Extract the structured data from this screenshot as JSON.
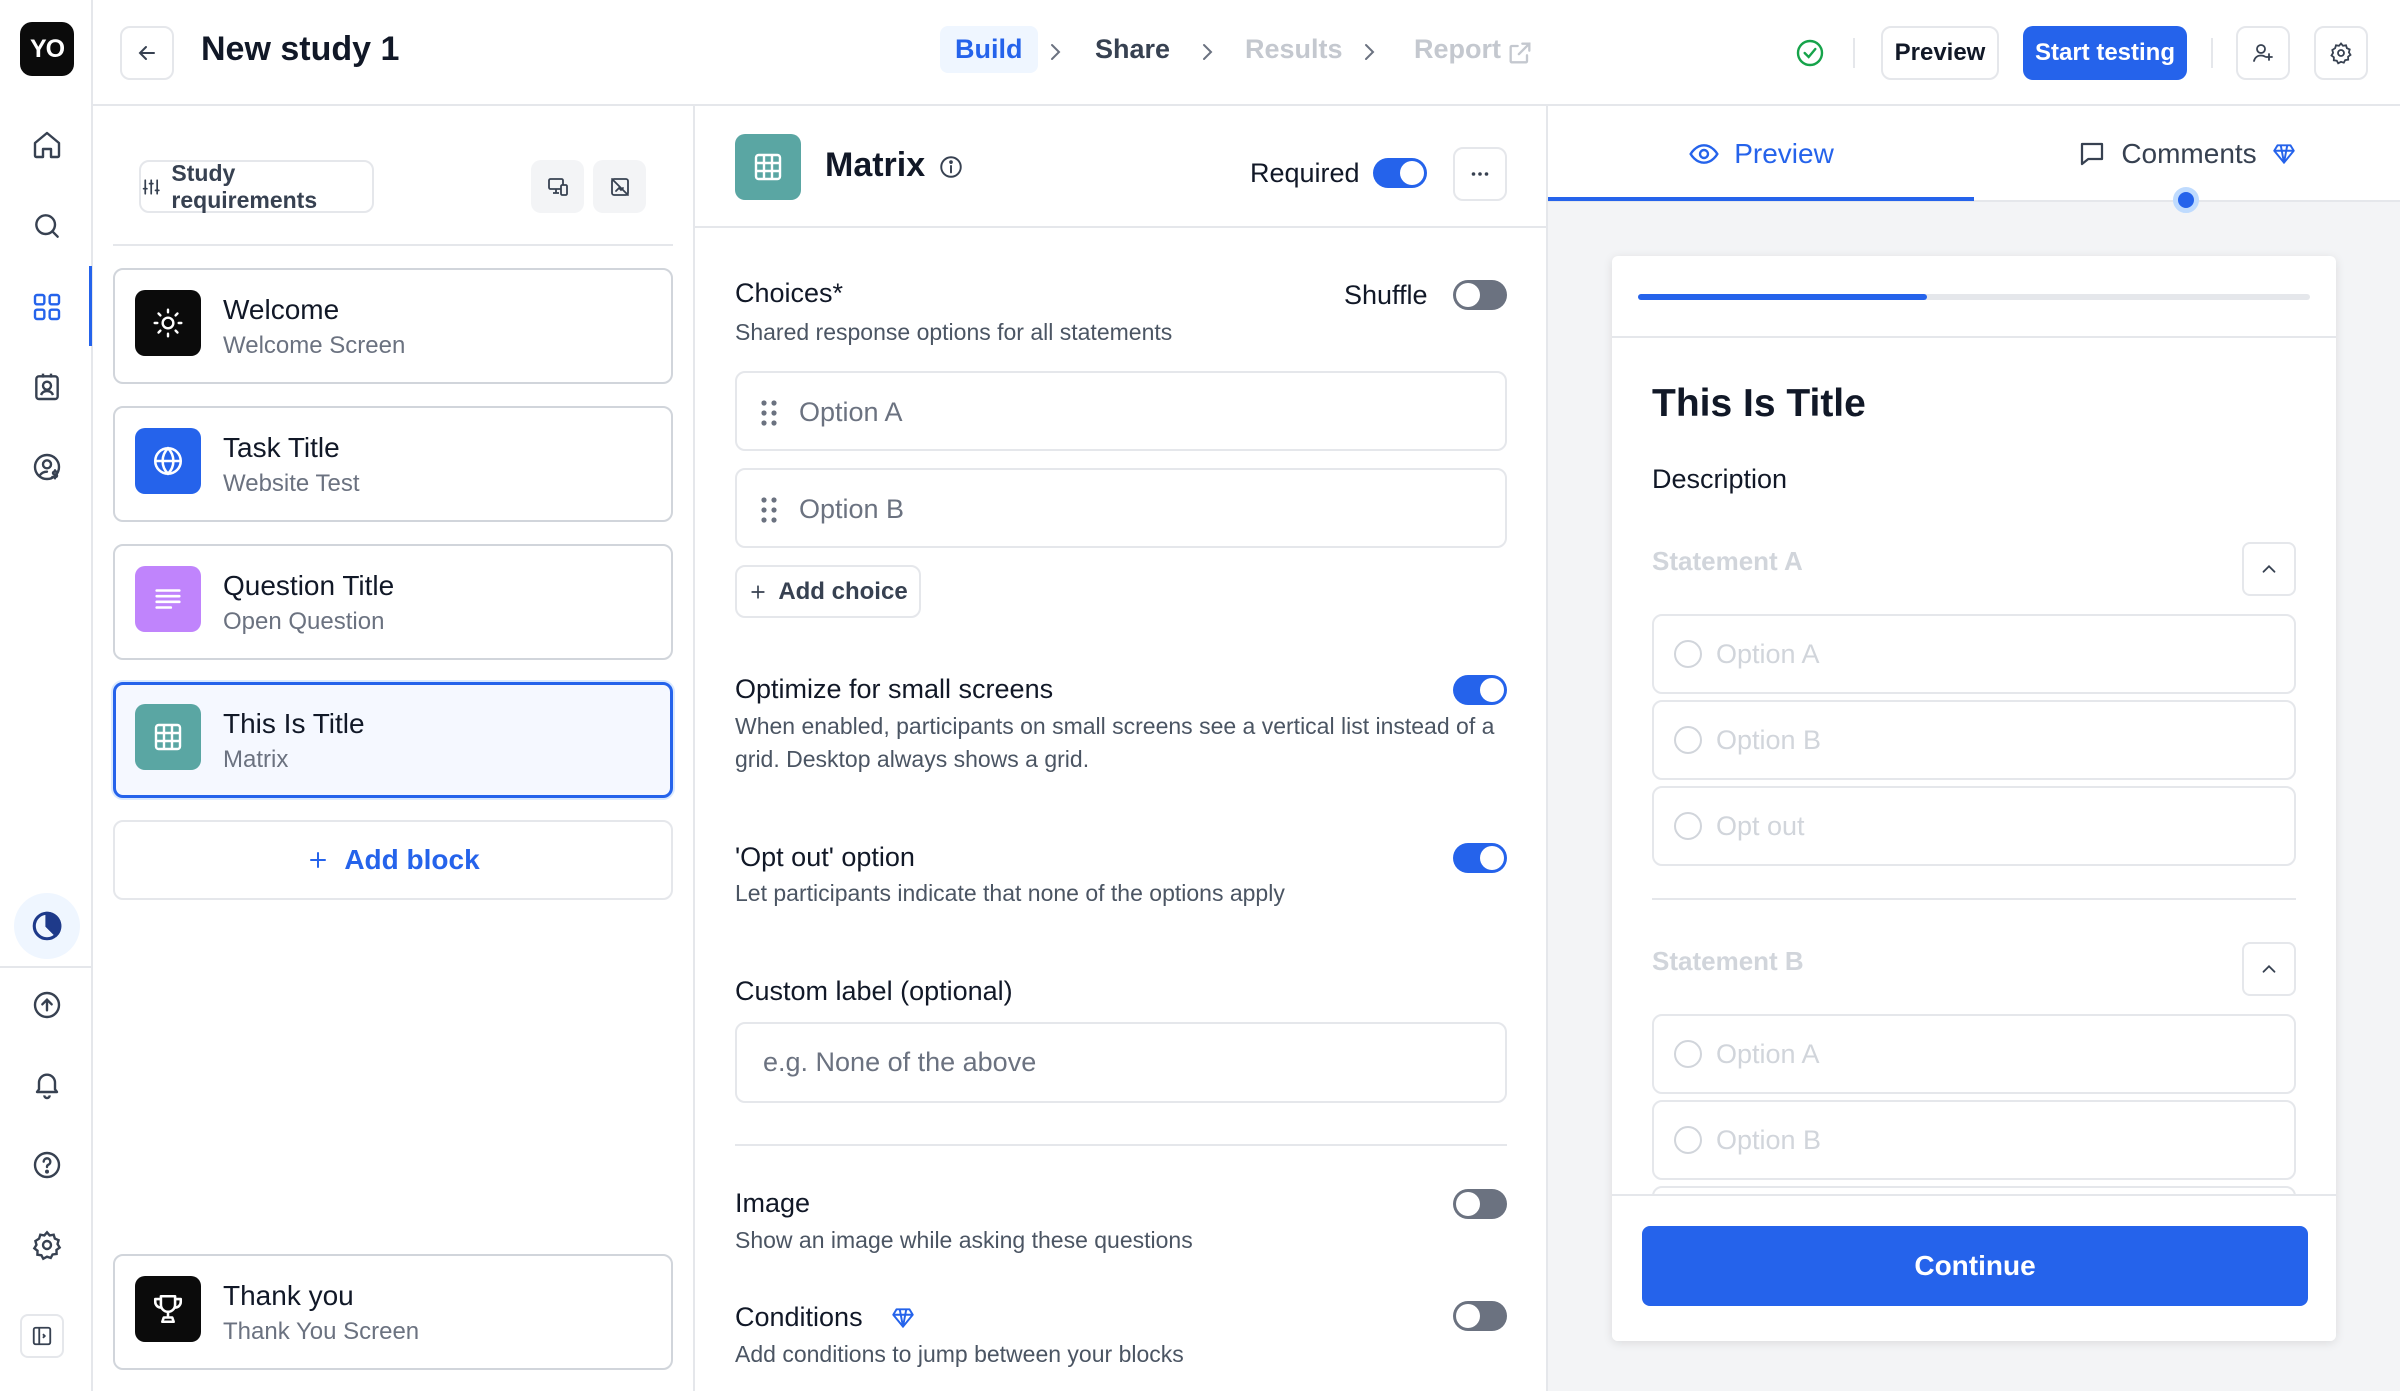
{
  "app": {
    "logo_text": "YO",
    "study_title": "New study 1"
  },
  "nav": {
    "steps": [
      {
        "label": "Build",
        "state": "active"
      },
      {
        "label": "Share",
        "state": "enabled"
      },
      {
        "label": "Results",
        "state": "disabled"
      },
      {
        "label": "Report",
        "state": "disabled"
      }
    ],
    "preview_label": "Preview",
    "start_label": "Start testing"
  },
  "blocks_panel": {
    "requirements_label": "Study requirements",
    "blocks": [
      {
        "title": "Welcome",
        "subtitle": "Welcome Screen",
        "icon": "sun-icon",
        "color": "#0b0b0b"
      },
      {
        "title": "Task Title",
        "subtitle": "Website Test",
        "icon": "globe-icon",
        "color": "#2563eb"
      },
      {
        "title": "Question Title",
        "subtitle": "Open Question",
        "icon": "lines-icon",
        "color": "#c084fc"
      },
      {
        "title": "This Is Title",
        "subtitle": "Matrix",
        "icon": "grid-icon",
        "color": "#5aa6a3",
        "selected": true
      }
    ],
    "add_block_label": "Add block",
    "end_block": {
      "title": "Thank you",
      "subtitle": "Thank You Screen",
      "icon": "trophy-icon",
      "color": "#0b0b0b"
    }
  },
  "editor": {
    "title": "Matrix",
    "required_label": "Required",
    "required_on": true,
    "choices_label": "Choices*",
    "choices_sub": "Shared response options for all statements",
    "shuffle_label": "Shuffle",
    "shuffle_on": false,
    "choices": [
      "Option A",
      "Option B"
    ],
    "add_choice_label": "Add choice",
    "optimize_label": "Optimize for small screens",
    "optimize_sub": "When enabled, participants on small screens see a vertical list instead of a grid. Desktop always shows a grid.",
    "optimize_on": true,
    "optout_label": "'Opt out' option",
    "optout_sub": "Let participants indicate that none of the options apply",
    "optout_on": true,
    "custom_label": "Custom label (optional)",
    "custom_placeholder": "e.g. None of the above",
    "custom_value": "",
    "image_label": "Image",
    "image_sub": "Show an image while asking these questions",
    "image_on": false,
    "conditions_label": "Conditions",
    "conditions_sub": "Add conditions to jump between your blocks",
    "conditions_on": false
  },
  "preview": {
    "tab_preview": "Preview",
    "tab_comments": "Comments",
    "progress": 0.43,
    "title": "This Is Title",
    "description": "Description",
    "statements": [
      {
        "label": "Statement A",
        "options": [
          "Option A",
          "Option B",
          "Opt out"
        ]
      },
      {
        "label": "Statement B",
        "options": [
          "Option A",
          "Option B"
        ]
      }
    ],
    "continue_label": "Continue"
  },
  "colors": {
    "accent": "#2563eb",
    "matrix": "#5aa6a3",
    "success": "#16a34a"
  }
}
